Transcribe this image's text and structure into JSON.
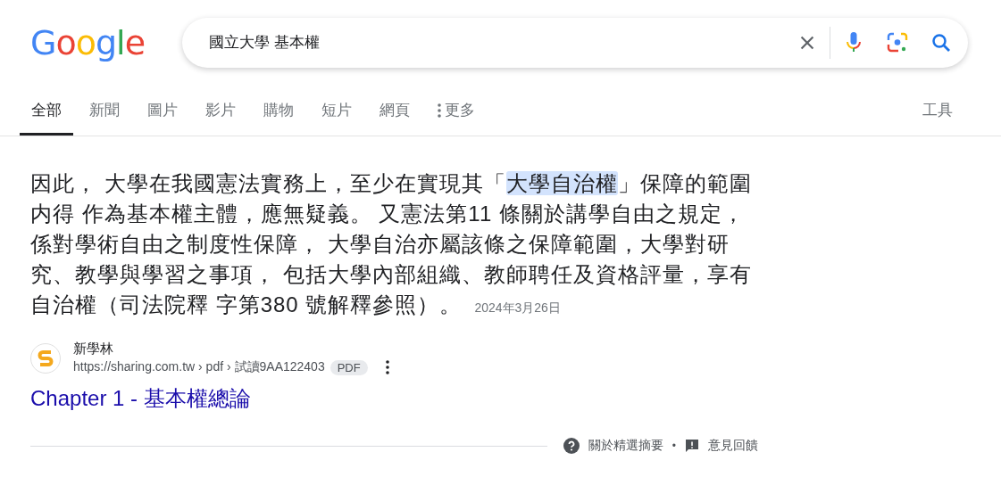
{
  "logo": "Google",
  "search": {
    "value": "國立大學 基本權"
  },
  "tabs": [
    {
      "label": "全部",
      "selected": true
    },
    {
      "label": "新聞",
      "selected": false
    },
    {
      "label": "圖片",
      "selected": false
    },
    {
      "label": "影片",
      "selected": false
    },
    {
      "label": "購物",
      "selected": false
    },
    {
      "label": "短片",
      "selected": false
    },
    {
      "label": "網頁",
      "selected": false
    },
    {
      "label": "更多",
      "selected": false,
      "kind": "menu"
    }
  ],
  "tools": "工具",
  "snippet": {
    "segments": [
      {
        "text": "因此， 大學在我國憲法實務上，至少在實現其「",
        "highlighted": false
      },
      {
        "text": "大學自治權",
        "highlighted": true
      },
      {
        "text": "」保障的範圍内得 作為基本權主體，應無疑義。 又憲法第11 條關於講學自由之規定，係對學術自由之制度性保障， 大學自治亦屬該條之保障範圍，大學對研究、教學與學習之事項， 包括大學內部組織、教師聘任及資格評量，享有自治權（司法院釋 字第380 號解釋參照）。",
        "highlighted": false
      }
    ],
    "date": "2024年3月26日"
  },
  "source": {
    "site": "新學林",
    "url": "https://sharing.com.tw › pdf › 試讀9AA122403",
    "badge": "PDF"
  },
  "result_title": "Chapter 1 - 基本權總論",
  "footer": {
    "about": "關於精選摘要",
    "separator": "•",
    "feedback": "意見回饋"
  }
}
